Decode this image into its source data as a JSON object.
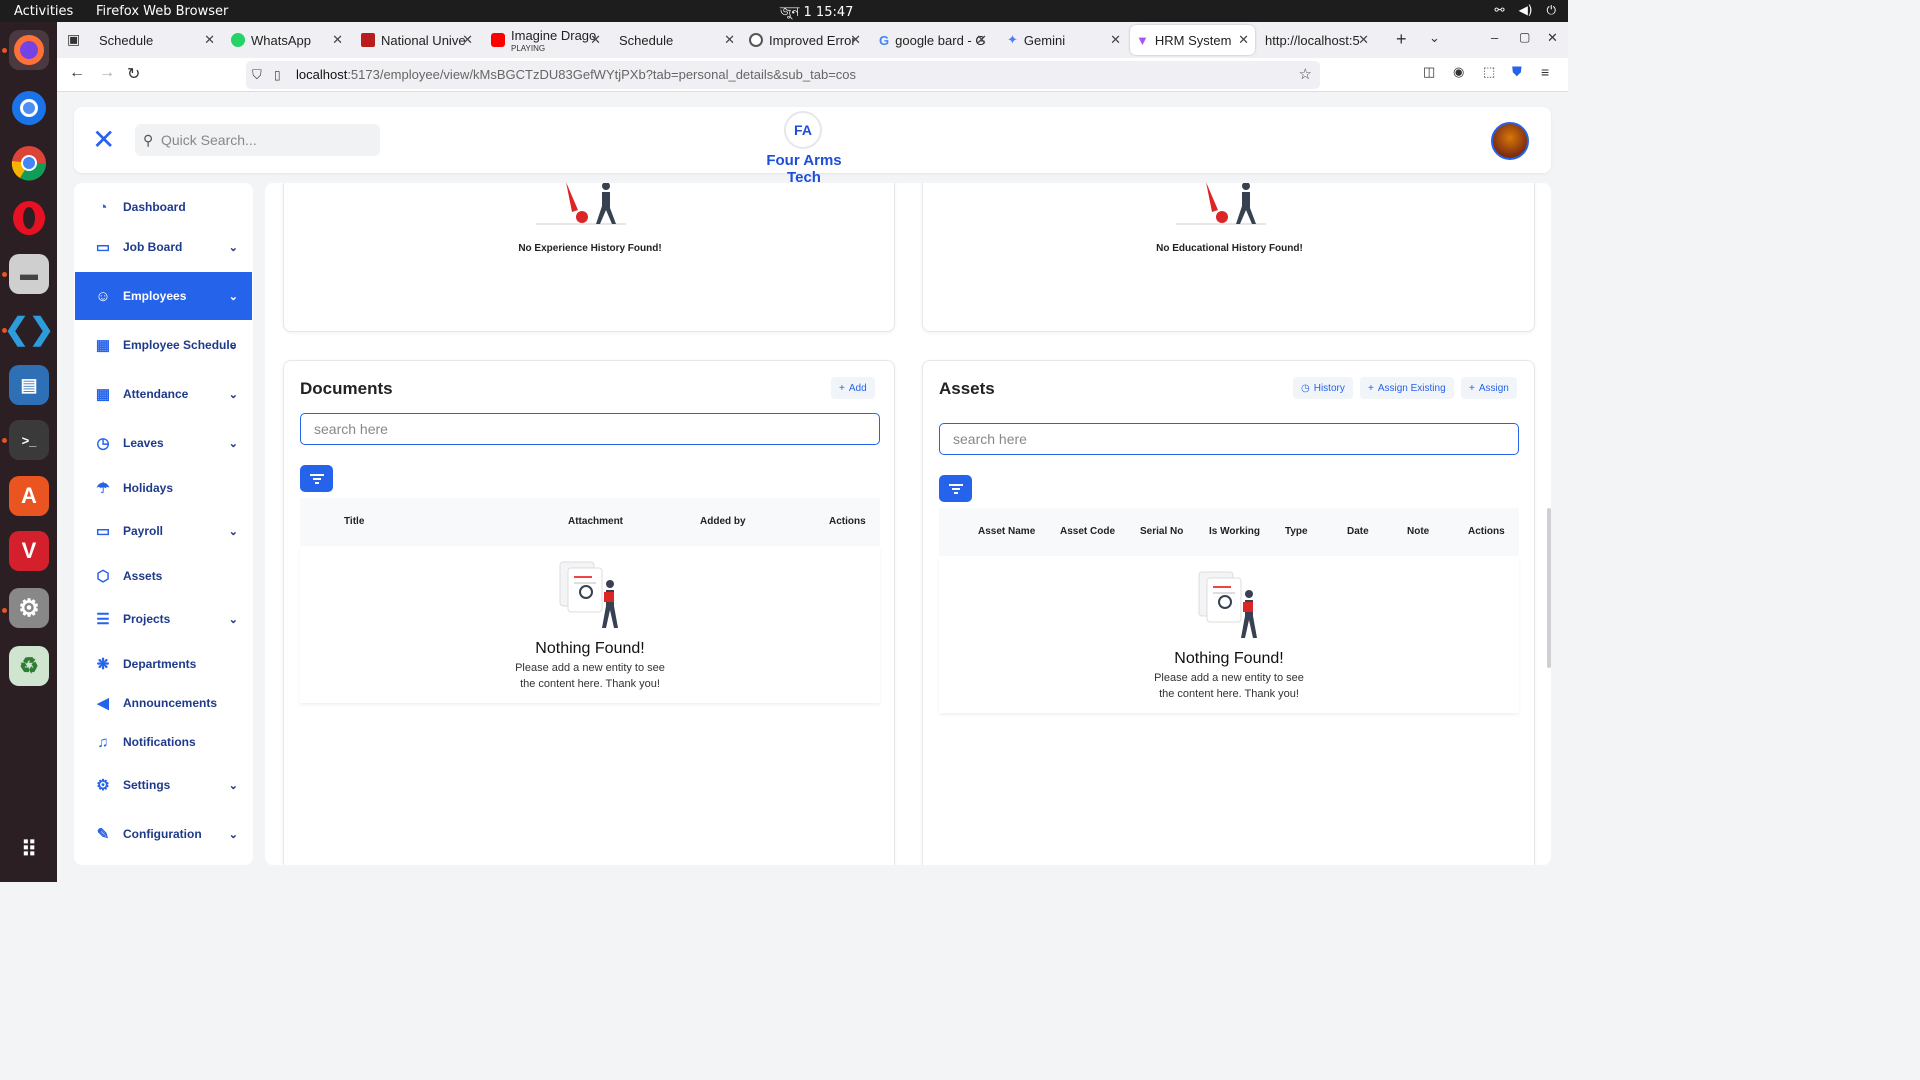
{
  "topbar": {
    "activities": "Activities",
    "app_name": "Firefox Web Browser",
    "clock": "জুন 1  15:47"
  },
  "tabs": [
    {
      "label": "Schedule"
    },
    {
      "label": "WhatsApp"
    },
    {
      "label": "National Unive"
    },
    {
      "label": "Imagine Drago",
      "sub": "PLAYING"
    },
    {
      "label": "Schedule"
    },
    {
      "label": "Improved Error"
    },
    {
      "label": "google bard - G"
    },
    {
      "label": "Gemini"
    },
    {
      "label": "HRM System"
    },
    {
      "label": "http://localhost:5"
    }
  ],
  "url": {
    "host": "localhost",
    "rest": ":5173/employee/view/kMsBGCTzDU83GefWYtjPXb?tab=personal_details&sub_tab=cos"
  },
  "header": {
    "search_placeholder": "Quick Search...",
    "brand": "Four Arms Tech",
    "logo_text": "FA"
  },
  "sidebar": {
    "items": [
      {
        "label": "Dashboard",
        "icon": "dashboard-icon",
        "glyph": "◔",
        "chevron": false
      },
      {
        "label": "Job Board",
        "icon": "inbox-icon",
        "glyph": "▭",
        "chevron": true
      },
      {
        "label": "Employees",
        "icon": "users-icon",
        "glyph": "☺",
        "chevron": true,
        "active": true
      },
      {
        "label": "Employee Schedule",
        "icon": "calendar-clock-icon",
        "glyph": "▦",
        "chevron": true
      },
      {
        "label": "Attendance",
        "icon": "calendar-icon",
        "glyph": "▦",
        "chevron": true
      },
      {
        "label": "Leaves",
        "icon": "clock-icon",
        "glyph": "◷",
        "chevron": true
      },
      {
        "label": "Holidays",
        "icon": "beach-icon",
        "glyph": "☂",
        "chevron": false
      },
      {
        "label": "Payroll",
        "icon": "credit-card-icon",
        "glyph": "▭",
        "chevron": true
      },
      {
        "label": "Assets",
        "icon": "box-icon",
        "glyph": "⬡",
        "chevron": false
      },
      {
        "label": "Projects",
        "icon": "list-icon",
        "glyph": "☰",
        "chevron": true
      },
      {
        "label": "Departments",
        "icon": "departments-icon",
        "glyph": "❋",
        "chevron": false
      },
      {
        "label": "Announcements",
        "icon": "megaphone-icon",
        "glyph": "◀",
        "chevron": false
      },
      {
        "label": "Notifications",
        "icon": "bell-icon",
        "glyph": "♫",
        "chevron": false
      },
      {
        "label": "Settings",
        "icon": "gear-icon",
        "glyph": "⚙",
        "chevron": true
      },
      {
        "label": "Configuration",
        "icon": "wrench-icon",
        "glyph": "✎",
        "chevron": true
      }
    ]
  },
  "experience": {
    "empty_text": "No Experience History Found!"
  },
  "education": {
    "empty_text": "No Educational History Found!"
  },
  "documents": {
    "title": "Documents",
    "add_label": "Add",
    "search_placeholder": "search here",
    "columns": [
      "Title",
      "Attachment",
      "Added by",
      "Actions"
    ],
    "empty_title": "Nothing Found!",
    "empty_line1": "Please add a new entity to see",
    "empty_line2": "the content here. Thank you!"
  },
  "assets": {
    "title": "Assets",
    "history_label": "History",
    "assign_existing_label": "Assign Existing",
    "assign_label": "Assign",
    "search_placeholder": "search here",
    "columns": [
      "Asset Name",
      "Asset Code",
      "Serial No",
      "Is Working",
      "Type",
      "Date",
      "Note",
      "Actions"
    ],
    "empty_title": "Nothing Found!",
    "empty_line1": "Please add a new entity to see",
    "empty_line2": "the content here. Thank you!"
  },
  "colors": {
    "primary": "#2563eb",
    "sidebar_text": "#1e3a8a",
    "dock": "#2b1f24"
  }
}
